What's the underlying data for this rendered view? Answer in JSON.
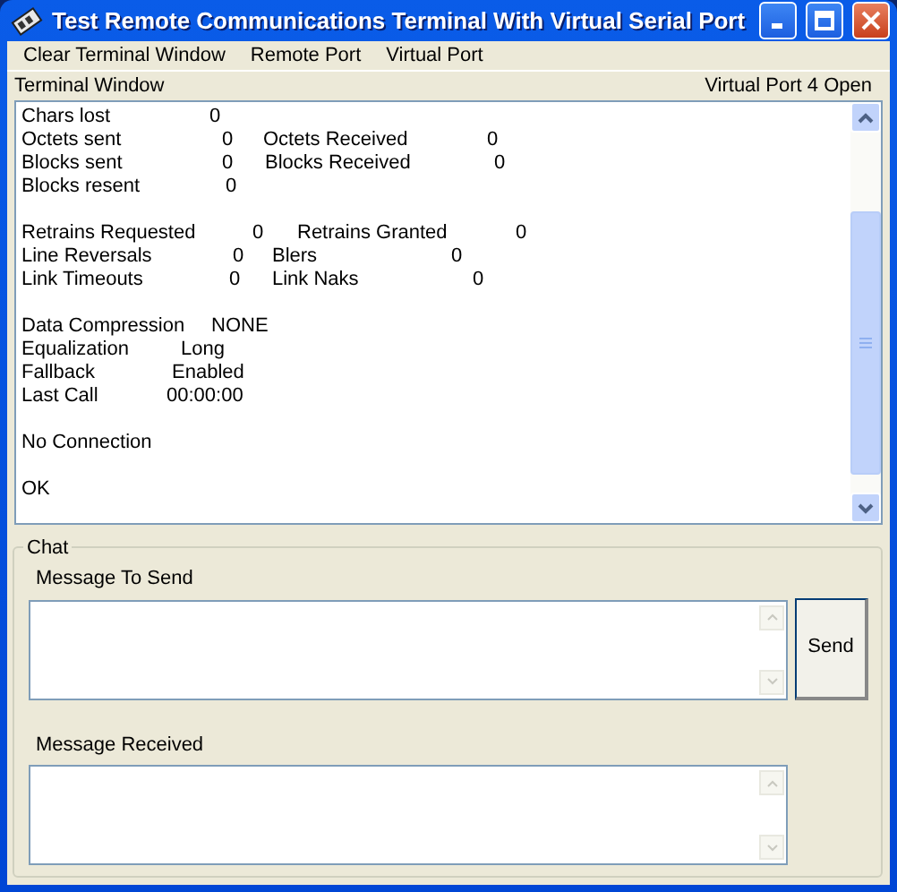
{
  "window": {
    "title": "Test Remote Communications Terminal With Virtual Serial Port"
  },
  "menu": [
    "Clear Terminal Window",
    "Remote Port",
    "Virtual Port"
  ],
  "status_row": {
    "left": "Terminal Window",
    "right": "Virtual Port 4 Open"
  },
  "terminal": {
    "blocks": [
      [
        [
          "Chars lost",
          "0"
        ],
        [
          "Octets sent",
          "0",
          "Octets Received",
          "0"
        ],
        [
          "Blocks sent",
          "0",
          "Blocks Received",
          "0"
        ],
        [
          "Blocks resent",
          "0"
        ]
      ],
      [
        [
          "Retrains Requested",
          "0",
          "Retrains Granted",
          "0"
        ],
        [
          "Line Reversals",
          "0",
          "Blers",
          "0"
        ],
        [
          "Link Timeouts",
          "0",
          "Link Naks",
          "0"
        ]
      ],
      [
        [
          "Data Compression",
          "NONE"
        ],
        [
          "Equalization",
          "Long"
        ],
        [
          "Fallback",
          "Enabled"
        ],
        [
          "Last Call",
          "00:00:00"
        ]
      ],
      [
        [
          "No Connection"
        ]
      ],
      [
        [
          "OK"
        ]
      ]
    ]
  },
  "chat": {
    "title": "Chat",
    "send_label": "Message To Send",
    "received_label": "Message Received",
    "send_button": "Send"
  }
}
